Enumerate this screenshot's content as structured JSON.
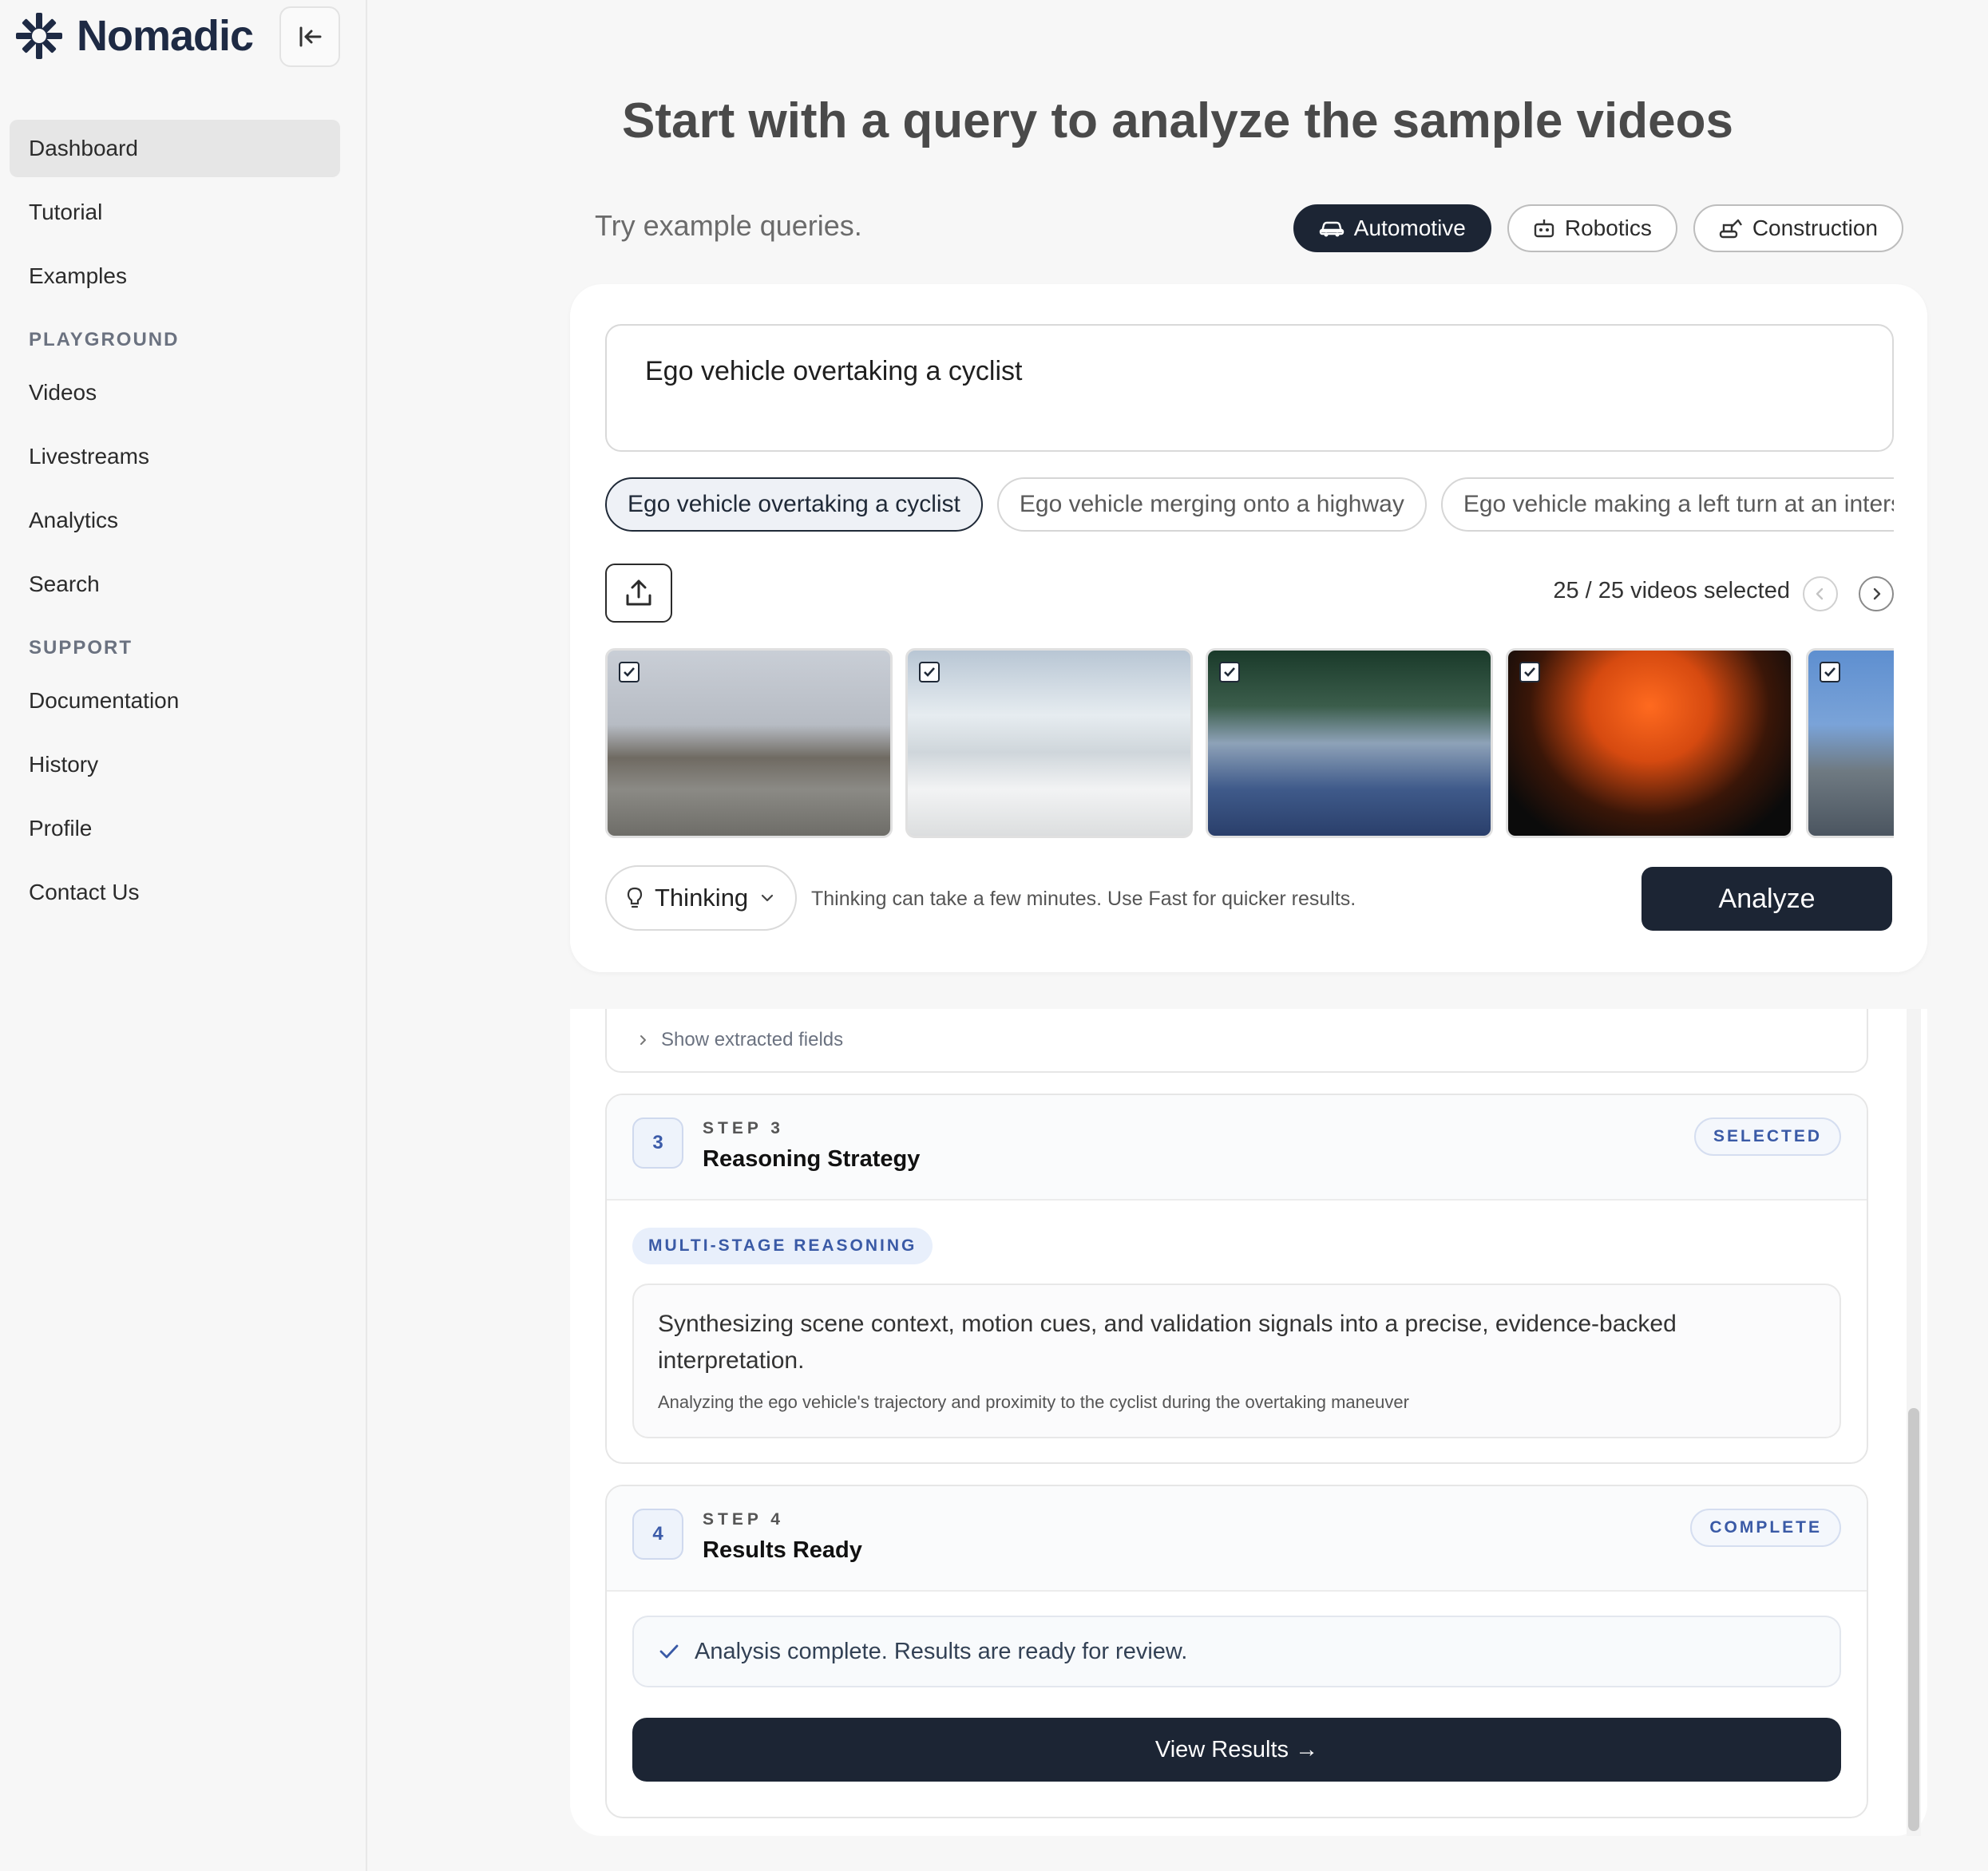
{
  "brand": {
    "name": "Nomadic"
  },
  "sidebar": {
    "items": [
      {
        "label": "Dashboard",
        "active": true
      },
      {
        "label": "Tutorial"
      },
      {
        "label": "Examples"
      }
    ],
    "playground_heading": "PLAYGROUND",
    "playground_items": [
      {
        "label": "Videos"
      },
      {
        "label": "Livestreams"
      },
      {
        "label": "Analytics"
      },
      {
        "label": "Search"
      }
    ],
    "support_heading": "SUPPORT",
    "support_items": [
      {
        "label": "Documentation"
      },
      {
        "label": "History"
      },
      {
        "label": "Profile"
      },
      {
        "label": "Contact Us"
      }
    ]
  },
  "main": {
    "headline": "Start with a query to analyze the sample videos",
    "try_label": "Try example queries.",
    "categories": [
      {
        "label": "Automotive",
        "icon": "car-icon",
        "active": true
      },
      {
        "label": "Robotics",
        "icon": "robot-icon"
      },
      {
        "label": "Construction",
        "icon": "excavator-icon"
      }
    ],
    "query": {
      "value": "Ego vehicle overtaking a cyclist"
    },
    "example_chips": [
      {
        "label": "Ego vehicle overtaking a cyclist",
        "active": true
      },
      {
        "label": "Ego vehicle merging onto a highway"
      },
      {
        "label": "Ego vehicle making a left turn at an interse"
      }
    ],
    "videos_selected": "25 / 25 videos selected",
    "mode": {
      "label": "Thinking",
      "note": "Thinking can take a few minutes. Use Fast for quicker results."
    },
    "analyze_label": "Analyze"
  },
  "steps": {
    "show_extracted": "Show extracted fields",
    "step3": {
      "number": "3",
      "kicker": "STEP 3",
      "title": "Reasoning Strategy",
      "badge": "SELECTED",
      "tag": "MULTI-STAGE REASONING",
      "main_text": "Synthesizing scene context, motion cues, and validation signals into a precise, evidence-backed interpretation.",
      "sub_text": "Analyzing the ego vehicle's trajectory and proximity to the cyclist during the overtaking maneuver"
    },
    "step4": {
      "number": "4",
      "kicker": "STEP 4",
      "title": "Results Ready",
      "badge": "COMPLETE",
      "message": "Analysis complete. Results are ready for review.",
      "button": "View Results →"
    }
  },
  "colors": {
    "primary_dark": "#1c2534",
    "accent_blue": "#3a5aa6",
    "brand_navy": "#1e2a44"
  }
}
